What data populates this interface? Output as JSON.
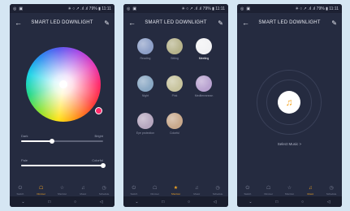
{
  "status_bar": {
    "left_icons": [
      "◎",
      "▣"
    ],
    "right_text": "✳ ○ ↗ .ıl .ıl 79% ▮ 11:11"
  },
  "app_title": "SMART LED DOWNLIGHT",
  "screens": {
    "color": {
      "slider1": {
        "left": "Dark",
        "right": "Bright",
        "value": 0.38
      },
      "slider2": {
        "left": "Pale",
        "right": "Colorful",
        "value": 1.0
      }
    },
    "scenes": {
      "items": [
        {
          "label": "Reading",
          "color": "#8ea0c8",
          "active": false
        },
        {
          "label": "Sitting",
          "color": "#b7b48c",
          "active": false
        },
        {
          "label": "Meeting",
          "color": "#f2f2f4",
          "active": true
        },
        {
          "label": "Night",
          "color": "#8aa8c4",
          "active": false
        },
        {
          "label": "Pink",
          "color": "#c8c49e",
          "active": false
        },
        {
          "label": "Mediterranean",
          "color": "#b9a3d0",
          "active": false
        },
        {
          "label": "Eye protection",
          "color": "#b6a7bf",
          "active": false
        },
        {
          "label": "Colorful",
          "color": "#c9a98c",
          "active": false
        }
      ]
    },
    "music": {
      "select_text": "Select Music >"
    }
  },
  "tabs": [
    {
      "label": "Switch",
      "icon": "⏻"
    },
    {
      "label": "Dimmer",
      "icon": "☖"
    },
    {
      "label": "Shortcut",
      "icon": "☆"
    },
    {
      "label": "Music",
      "icon": "♫"
    },
    {
      "label": "Schedule",
      "icon": "◷"
    }
  ],
  "active_tabs": [
    "Dimmer",
    "Shortcut",
    "Music"
  ],
  "system_nav": [
    "⌄",
    "□",
    "○",
    "◁"
  ],
  "colors": {
    "background": "#d5e6f3",
    "screen": "#252b40",
    "accent": "#f5a623"
  }
}
